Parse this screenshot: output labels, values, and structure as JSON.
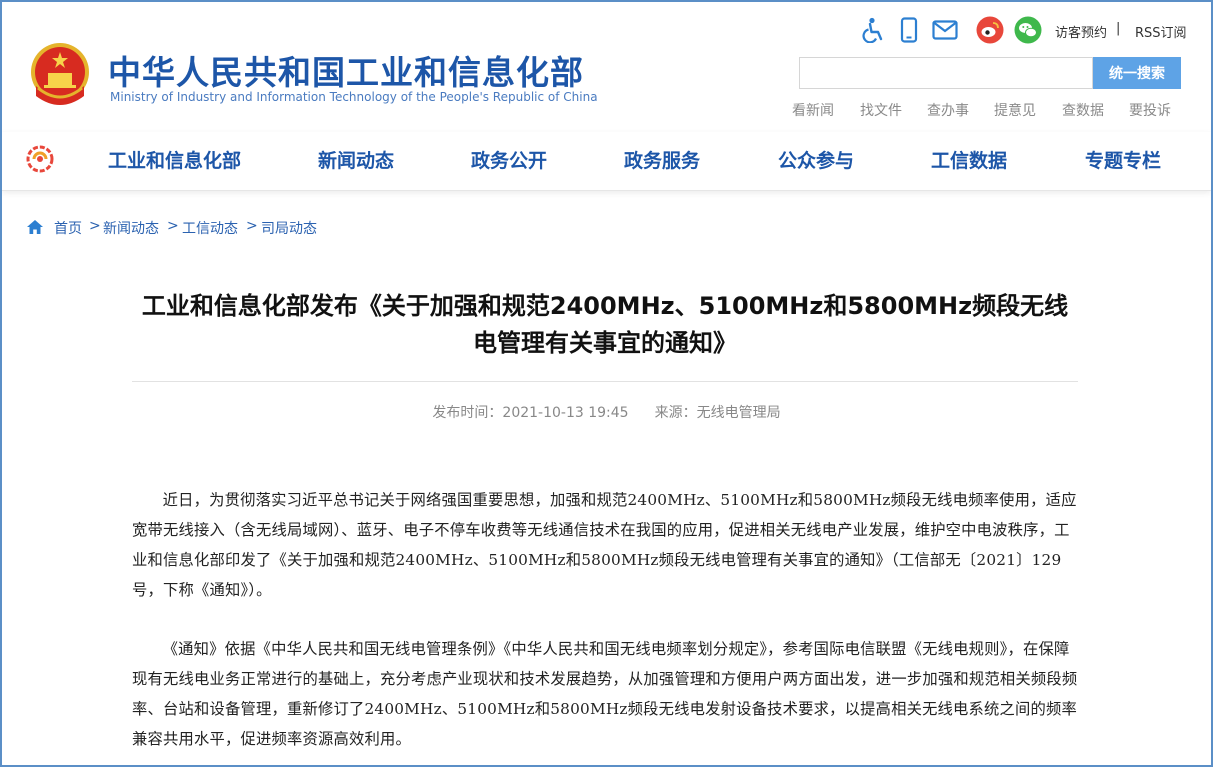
{
  "header": {
    "title": "中华人民共和国工业和信息化部",
    "subtitle": "Ministry of Industry and Information Technology of the People's Republic of China",
    "tools": {
      "visitor_booking": "访客预约",
      "separator": "|",
      "rss": "RSS订阅"
    },
    "search": {
      "placeholder": "",
      "button_label": "统一搜索"
    },
    "quick_links": [
      "看新闻",
      "找文件",
      "查办事",
      "提意见",
      "查数据",
      "要投诉"
    ]
  },
  "nav": {
    "items": [
      "工业和信息化部",
      "新闻动态",
      "政务公开",
      "政务服务",
      "公众参与",
      "工信数据",
      "专题专栏"
    ]
  },
  "breadcrumb": {
    "items": [
      "首页",
      "新闻动态",
      "工信动态",
      "司局动态"
    ],
    "separator": ">"
  },
  "article": {
    "title_line1": "工业和信息化部发布《关于加强和规范2400MHz、5100MHz和5800MHz频段无线",
    "title_line2": "电管理有关事宜的通知》",
    "publish_time": "发布时间：2021-10-13 19:45",
    "source": "来源：无线电管理局",
    "paragraphs": [
      "近日，为贯彻落实习近平总书记关于网络强国重要思想，加强和规范2400MHz、5100MHz和5800MHz频段无线电频率使用，适应宽带无线接入（含无线局域网）、蓝牙、电子不停车收费等无线通信技术在我国的应用，促进相关无线电产业发展，维护空中电波秩序，工业和信息化部印发了《关于加强和规范2400MHz、5100MHz和5800MHz频段无线电管理有关事宜的通知》（工信部无〔2021〕129号，下称《通知》）。",
      "《通知》依据《中华人民共和国无线电管理条例》《中华人民共和国无线电频率划分规定》，参考国际电信联盟《无线电规则》，在保障现有无线电业务正常进行的基础上，充分考虑产业现状和技术发展趋势，从加强管理和方便用户两方面出发，进一步加强和规范相关频段频率、台站和设备管理，重新修订了2400MHz、5100MHz和5800MHz频段无线电发射设备技术要求，以提高相关无线电系统之间的频率兼容共用水平，促进频率资源高效利用。"
    ]
  },
  "colors": {
    "brand_blue": "#1d56a8",
    "search_button": "#5ea3e6",
    "weibo_red": "#e8473b",
    "wechat_green": "#3fb84c",
    "icon_blue": "#2c7fd1"
  },
  "icons": [
    "emblem-logo",
    "accessibility-icon",
    "mobile-icon",
    "mail-icon",
    "weibo-icon",
    "wechat-icon",
    "nav-logo-icon",
    "home-icon"
  ]
}
